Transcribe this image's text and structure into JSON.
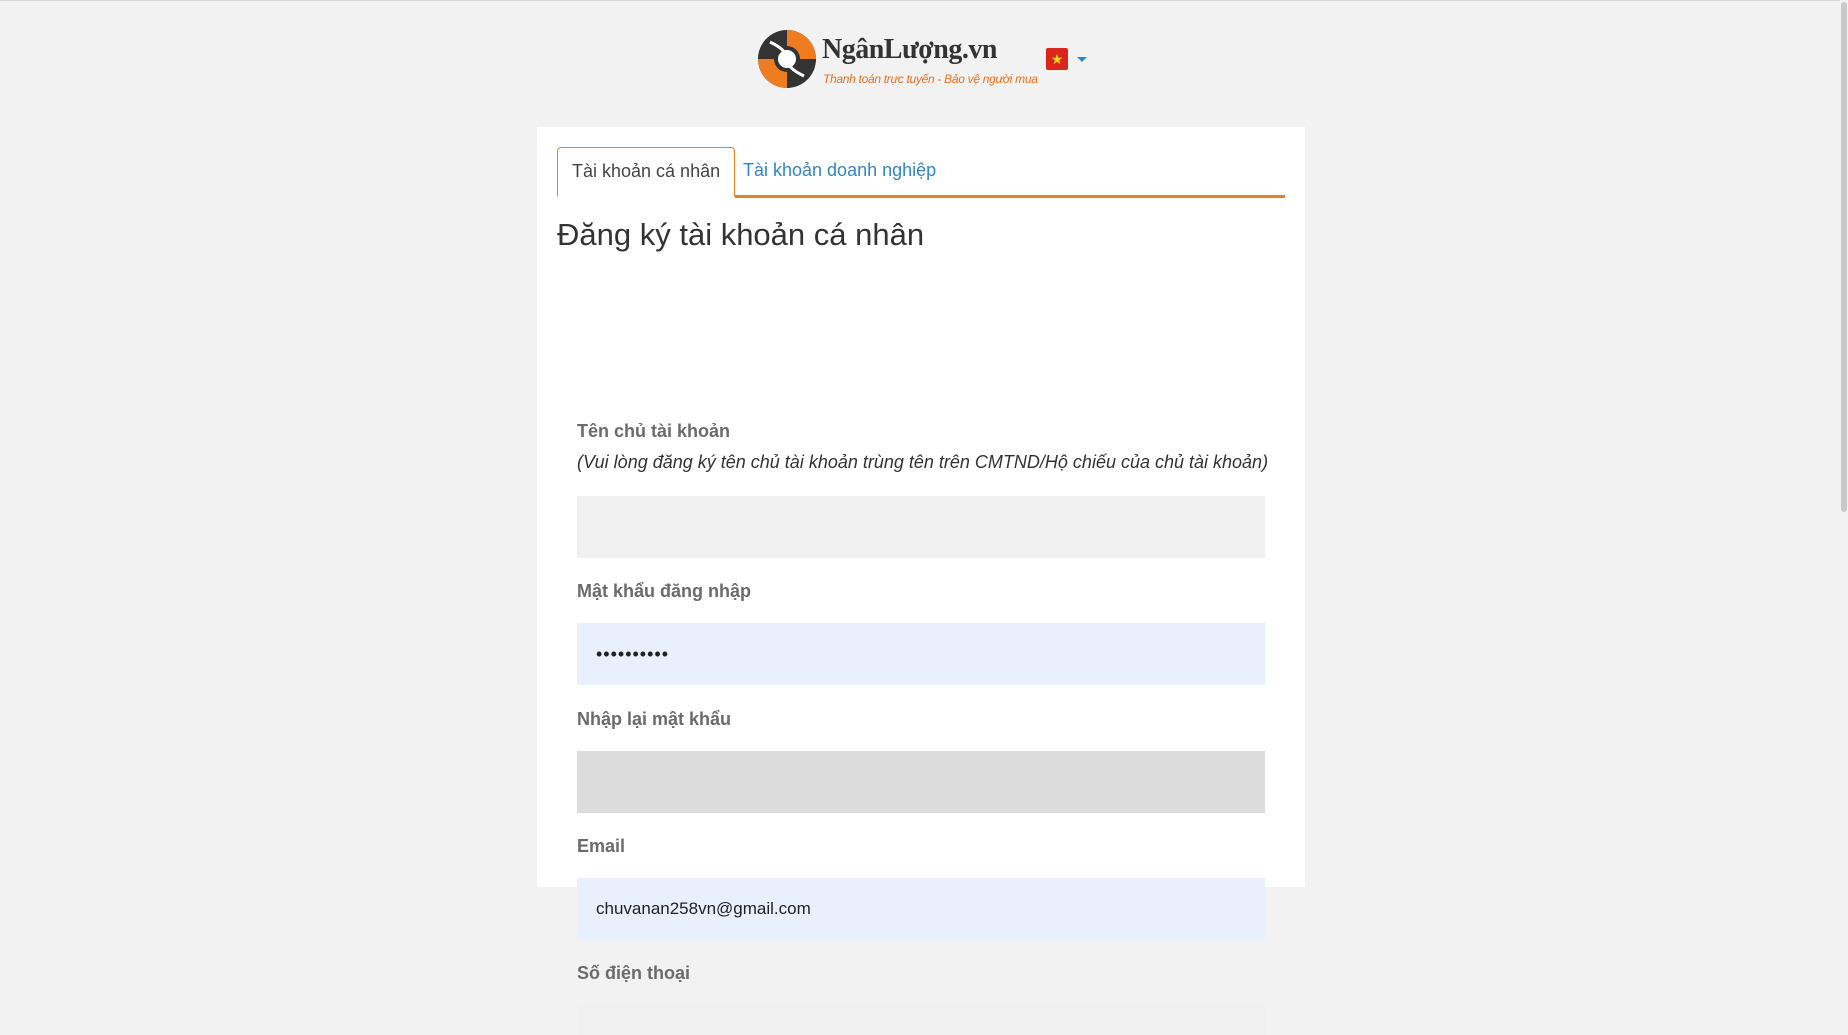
{
  "header": {
    "logo_name": "NgânLượng.vn",
    "logo_tagline": "Thanh toán trực tuyến - Bảo vệ người mua",
    "language_flag": "vietnam-flag-icon",
    "flag_star": "★"
  },
  "tabs": [
    {
      "label": "Tài khoản cá nhân",
      "active": true
    },
    {
      "label": "Tài khoản doanh nghiệp",
      "active": false
    }
  ],
  "form": {
    "title": "Đăng ký tài khoản cá nhân",
    "account_name": {
      "label": "Tên chủ tài khoản",
      "hint": "(Vui lòng đăng ký tên chủ tài khoản trùng tên trên CMTND/Hộ chiếu của chủ tài khoản)",
      "value": ""
    },
    "password": {
      "label": "Mật khẩu đăng nhập",
      "value": "••••••••••"
    },
    "confirm_password": {
      "label": "Nhập lại mật khẩu",
      "value": ""
    },
    "email": {
      "label": "Email",
      "value": "chuvanan258vn@gmail.com"
    },
    "phone": {
      "label": "Số điện thoại"
    }
  },
  "colors": {
    "accent": "#ef7d1f",
    "link": "#2f87c8",
    "background": "#f2f2f2",
    "autofill": "#e8f0fe"
  }
}
